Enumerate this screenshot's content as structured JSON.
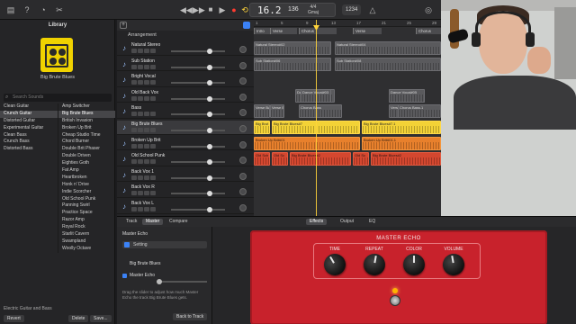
{
  "colors": {
    "accent": "#3b82f6",
    "region_gray": "#5a5a5d",
    "region_yellow": "#f3d236",
    "region_orange": "#e8802c",
    "region_red": "#d4472f",
    "pedal_red": "#c8222c",
    "playhead": "#ffd43b"
  },
  "toolbar": {
    "rewind_icon": "rewind-icon",
    "forward_icon": "forward-icon",
    "stop_icon": "stop-icon",
    "play_icon": "play-icon",
    "record_icon": "record-icon",
    "cycle_icon": "cycle-icon",
    "lcd_position": "16.2",
    "lcd_tempo": "136",
    "lcd_sig": "4/4",
    "lcd_key": "Gmaj",
    "key_pill": "1234"
  },
  "library": {
    "title": "Library",
    "patch_name": "Big Brute Blues",
    "search_placeholder": "Search Sounds",
    "categories": [
      {
        "label": "Clean Guitar"
      },
      {
        "label": "Crunch Guitar"
      },
      {
        "label": "Distorted Guitar"
      },
      {
        "label": "Experimental Guitar"
      },
      {
        "label": "Clean Bass"
      },
      {
        "label": "Crunch Bass"
      },
      {
        "label": "Distorted Bass"
      }
    ],
    "patches": [
      {
        "label": "Amp Switcher"
      },
      {
        "label": "Big Brute Blues"
      },
      {
        "label": "British Invasion"
      },
      {
        "label": "Broken Up Brit"
      },
      {
        "label": "Cheap Studio Time"
      },
      {
        "label": "Chord Burner"
      },
      {
        "label": "Double Brit Phaser"
      },
      {
        "label": "Double Driven"
      },
      {
        "label": "Eighties Goth"
      },
      {
        "label": "Fat Amp"
      },
      {
        "label": "Heartbroken"
      },
      {
        "label": "Honk n' Drive"
      },
      {
        "label": "Indie Scorcher"
      },
      {
        "label": "Old School Punk"
      },
      {
        "label": "Panning Swirl"
      },
      {
        "label": "Practice Space"
      },
      {
        "label": "Razor Amp"
      },
      {
        "label": "Royal Rock"
      },
      {
        "label": "Starlit Cavern"
      },
      {
        "label": "Swampland"
      },
      {
        "label": "Woolly Octave"
      }
    ],
    "breadcrumb": "Electric Guitar and Bass",
    "revert": "Revert",
    "delete": "Delete",
    "save": "Save..."
  },
  "arrangement": {
    "label": "Arrangement",
    "bars": [
      "1",
      "5",
      "9",
      "13",
      "17",
      "21",
      "25",
      "29"
    ],
    "markers": [
      {
        "label": "Intro",
        "offset": 0,
        "length": 18
      },
      {
        "label": "Verse",
        "offset": 18,
        "length": 30
      },
      {
        "label": "Chorus",
        "offset": 50,
        "length": 42
      },
      {
        "label": "Verse",
        "offset": 110,
        "length": 32
      },
      {
        "label": "Chorus",
        "offset": 180,
        "length": 28
      }
    ]
  },
  "tracks": [
    {
      "name": "Natural Stereo",
      "icon": "microphone-icon",
      "regions": [
        {
          "label": "Natural Stereo#02",
          "color": "gray",
          "offset": 0,
          "length": 86
        },
        {
          "label": "Natural Stereo#04",
          "color": "gray",
          "offset": 90,
          "length": 118
        }
      ]
    },
    {
      "name": "Sub Station",
      "icon": "microphone-icon",
      "regions": [
        {
          "label": "Sub Station#06",
          "color": "gray",
          "offset": 0,
          "length": 86
        },
        {
          "label": "Sub Station#08",
          "color": "gray",
          "offset": 90,
          "length": 118
        }
      ]
    },
    {
      "name": "Bright Vocal",
      "icon": "microphone-icon",
      "regions": []
    },
    {
      "name": "Old Back Vox",
      "icon": "microphone-icon",
      "regions": [
        {
          "label": "Dance Vocal#01",
          "color": "gray",
          "offset": 46,
          "length": 44
        },
        {
          "label": "Dance Vocal#01",
          "color": "gray",
          "offset": 150,
          "length": 40
        },
        {
          "label": "Dance Vocal#03",
          "color": "gray",
          "offset": 52,
          "length": 34
        },
        {
          "label": "Dance Vocal#05",
          "color": "gray",
          "offset": 150,
          "length": 40
        }
      ]
    },
    {
      "name": "Bass",
      "icon": "bass-guitar-icon",
      "regions": [
        {
          "label": "Verse Ba",
          "color": "gray",
          "offset": 0,
          "length": 18
        },
        {
          "label": "Verse Ba",
          "color": "gray",
          "offset": 18,
          "length": 16
        },
        {
          "label": "Chorus Bass",
          "color": "gray",
          "offset": 50,
          "length": 48
        },
        {
          "label": "Verse Ba",
          "color": "gray",
          "offset": 150,
          "length": 18
        },
        {
          "label": "Chorus Bass.1",
          "color": "gray",
          "offset": 160,
          "length": 56
        }
      ]
    },
    {
      "name": "Big Brute Blues",
      "icon": "guitar-icon",
      "selected": true,
      "regions": [
        {
          "label": "Big Brut",
          "color": "yellow",
          "offset": 0,
          "length": 18
        },
        {
          "label": "Big Brute Blues#7",
          "color": "yellow",
          "offset": 20,
          "length": 98
        },
        {
          "label": "Big Brute Blues#7.1",
          "color": "yellow",
          "offset": 120,
          "length": 108
        }
      ]
    },
    {
      "name": "Broken Up Brit",
      "icon": "guitar-icon",
      "regions": [
        {
          "label": "Broken Up Brit#01",
          "color": "orange",
          "offset": 0,
          "length": 118
        },
        {
          "label": "Broken Up Brit#01.1",
          "color": "orange",
          "offset": 120,
          "length": 88
        }
      ]
    },
    {
      "name": "Old School Punk",
      "icon": "guitar-icon",
      "regions": [
        {
          "label": "Old Sch",
          "color": "red",
          "offset": 0,
          "length": 18
        },
        {
          "label": "Old Sc",
          "color": "red",
          "offset": 20,
          "length": 18
        },
        {
          "label": "Big Brute Blues#2",
          "color": "red",
          "offset": 40,
          "length": 68
        },
        {
          "label": "Old Sc",
          "color": "red",
          "offset": 110,
          "length": 18
        },
        {
          "label": "Big Brute Blues#2",
          "color": "red",
          "offset": 130,
          "length": 78
        }
      ]
    },
    {
      "name": "Back Vox 1",
      "icon": "microphone-icon",
      "regions": []
    },
    {
      "name": "Back Vox R",
      "icon": "microphone-icon",
      "regions": []
    },
    {
      "name": "Back Vox L",
      "icon": "microphone-icon",
      "regions": []
    }
  ],
  "bottom": {
    "tabs_left": [
      "Track",
      "Master",
      "Compare"
    ],
    "tabs_right": [
      "Effects",
      "Output",
      "EQ"
    ],
    "active_left": "Master",
    "active_right": "Effects",
    "inspector": {
      "channel": "Master Echo",
      "setting_placeholder": "Setting",
      "patch": "Big Brute Blues",
      "echo_label": "Master Echo",
      "help": "Drag the slider to adjust how much Master Echo the track Big Brute Blues gets.",
      "back": "Back to Track"
    },
    "pedal": {
      "title": "MASTER ECHO",
      "knobs": [
        {
          "label": "TIME",
          "angle": -30
        },
        {
          "label": "REPEAT",
          "angle": 10
        },
        {
          "label": "COLOR",
          "angle": 0
        },
        {
          "label": "VOLUME",
          "angle": -10
        }
      ]
    }
  }
}
